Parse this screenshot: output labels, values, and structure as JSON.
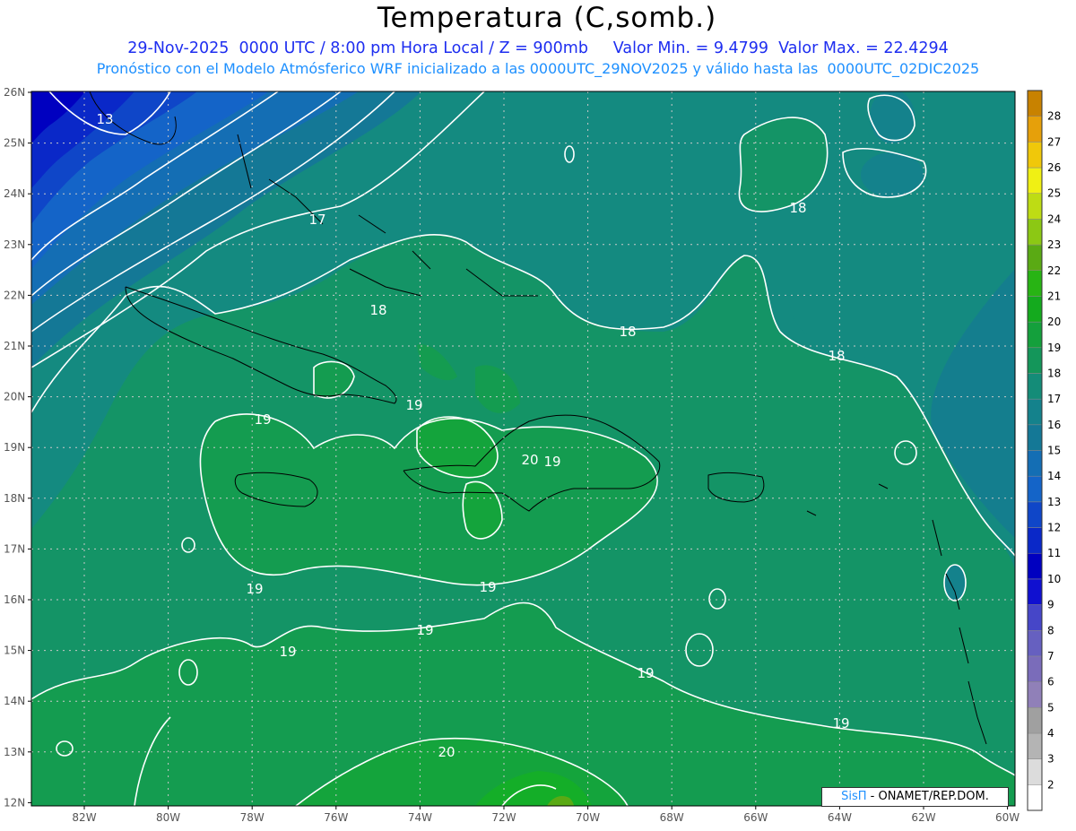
{
  "header": {
    "title": "Temperatura (C,somb.)",
    "line1": "29-Nov-2025  0000 UTC / 8:00 pm Hora Local / Z = 900mb     Valor Min. = 9.4799  Valor Max. = 22.4294",
    "line2": "Pronóstico con el Modelo Atmósferico WRF inicializado a las 0000UTC_29NOV2025 y válido hasta las  0000UTC_02DIC2025"
  },
  "axes": {
    "lat_ticks": [
      "26N",
      "25N",
      "24N",
      "23N",
      "22N",
      "21N",
      "20N",
      "19N",
      "18N",
      "17N",
      "16N",
      "15N",
      "14N",
      "13N",
      "12N"
    ],
    "lon_ticks": [
      "82W",
      "80W",
      "78W",
      "76W",
      "74W",
      "72W",
      "70W",
      "68W",
      "66W",
      "64W",
      "62W",
      "60W"
    ]
  },
  "colorbar": {
    "labels": [
      "2",
      "3",
      "4",
      "5",
      "6",
      "7",
      "8",
      "9",
      "10",
      "11",
      "12",
      "13",
      "14",
      "15",
      "16",
      "17",
      "18",
      "19",
      "20",
      "21",
      "22",
      "23",
      "24",
      "25",
      "26",
      "27",
      "28"
    ],
    "colors": [
      "#ffffff",
      "#dcdcdc",
      "#b4b4b4",
      "#a0a0a0",
      "#9080b8",
      "#7a6cba",
      "#6660c0",
      "#4646c8",
      "#1010d0",
      "#0000c0",
      "#0a28c8",
      "#0f46c8",
      "#1464c8",
      "#146eb4",
      "#147896",
      "#14828c",
      "#148c78",
      "#14965a",
      "#14a03c",
      "#14aa1e",
      "#28b414",
      "#5aaa14",
      "#8cc814",
      "#bedc14",
      "#f0f014",
      "#f0c80a",
      "#e6a00a",
      "#c88200"
    ]
  },
  "contours": {
    "labels": [
      "13",
      "17",
      "18",
      "18",
      "18",
      "18",
      "19",
      "19",
      "19",
      "19",
      "19",
      "19",
      "19",
      "19",
      "20",
      "20",
      "19"
    ]
  },
  "credit": {
    "sis": "SisΠ",
    "rest": "- ONAMET/REP.DOM."
  }
}
